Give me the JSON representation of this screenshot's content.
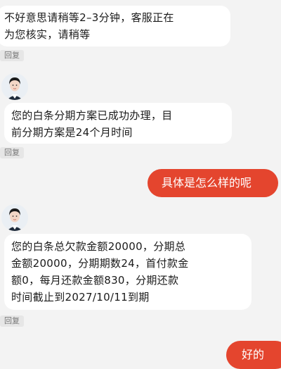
{
  "messages": [
    {
      "text": "不好意思请稍等2–3分钟，客服正在\n为您核实，请稍等",
      "reply": "回复"
    },
    {
      "text": "您的白条分期方案已成功办理，目\n前分期方案是24个月时间",
      "reply": "回复"
    },
    {
      "text": "具体是怎么样的呢"
    },
    {
      "text": "您的白条总欠款金额20000，分期总\n金额20000，分期期数24，首付款金\n额0，每月还款金额830，分期还款\n时间截止到2027/10/11到期",
      "reply": "回复"
    },
    {
      "text": "好的"
    }
  ],
  "colors": {
    "user_bubble": "#e4452e",
    "agent_bubble": "#ffffff",
    "background": "#f3f3f3"
  },
  "icons": {
    "avatar": "agent-avatar-icon"
  }
}
